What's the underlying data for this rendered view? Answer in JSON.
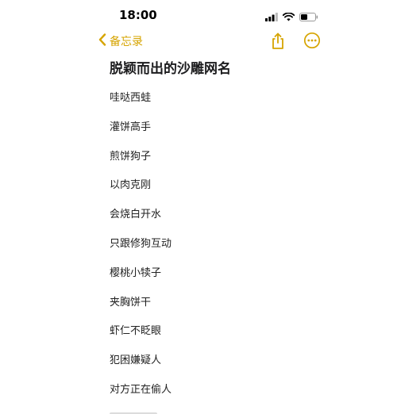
{
  "status_bar": {
    "time": "18:00",
    "icons": [
      "cellular-signal-icon",
      "wifi-icon",
      "battery-icon"
    ]
  },
  "nav": {
    "back_label": "备忘录",
    "accent_color": "#d6a400",
    "icons": [
      "chevron-left-icon",
      "share-icon",
      "more-icon"
    ]
  },
  "note": {
    "title": "脱颖而出的沙雕网名",
    "items": [
      "哇哒西蛙",
      "灌饼高手",
      "煎饼狗子",
      "以肉克刚",
      "会烧白开水",
      "只跟修狗互动",
      "樱桃小犊子",
      "夹胸饼干",
      "虾仁不眨眼",
      "犯困嫌疑人",
      "对方正在偷人"
    ]
  }
}
